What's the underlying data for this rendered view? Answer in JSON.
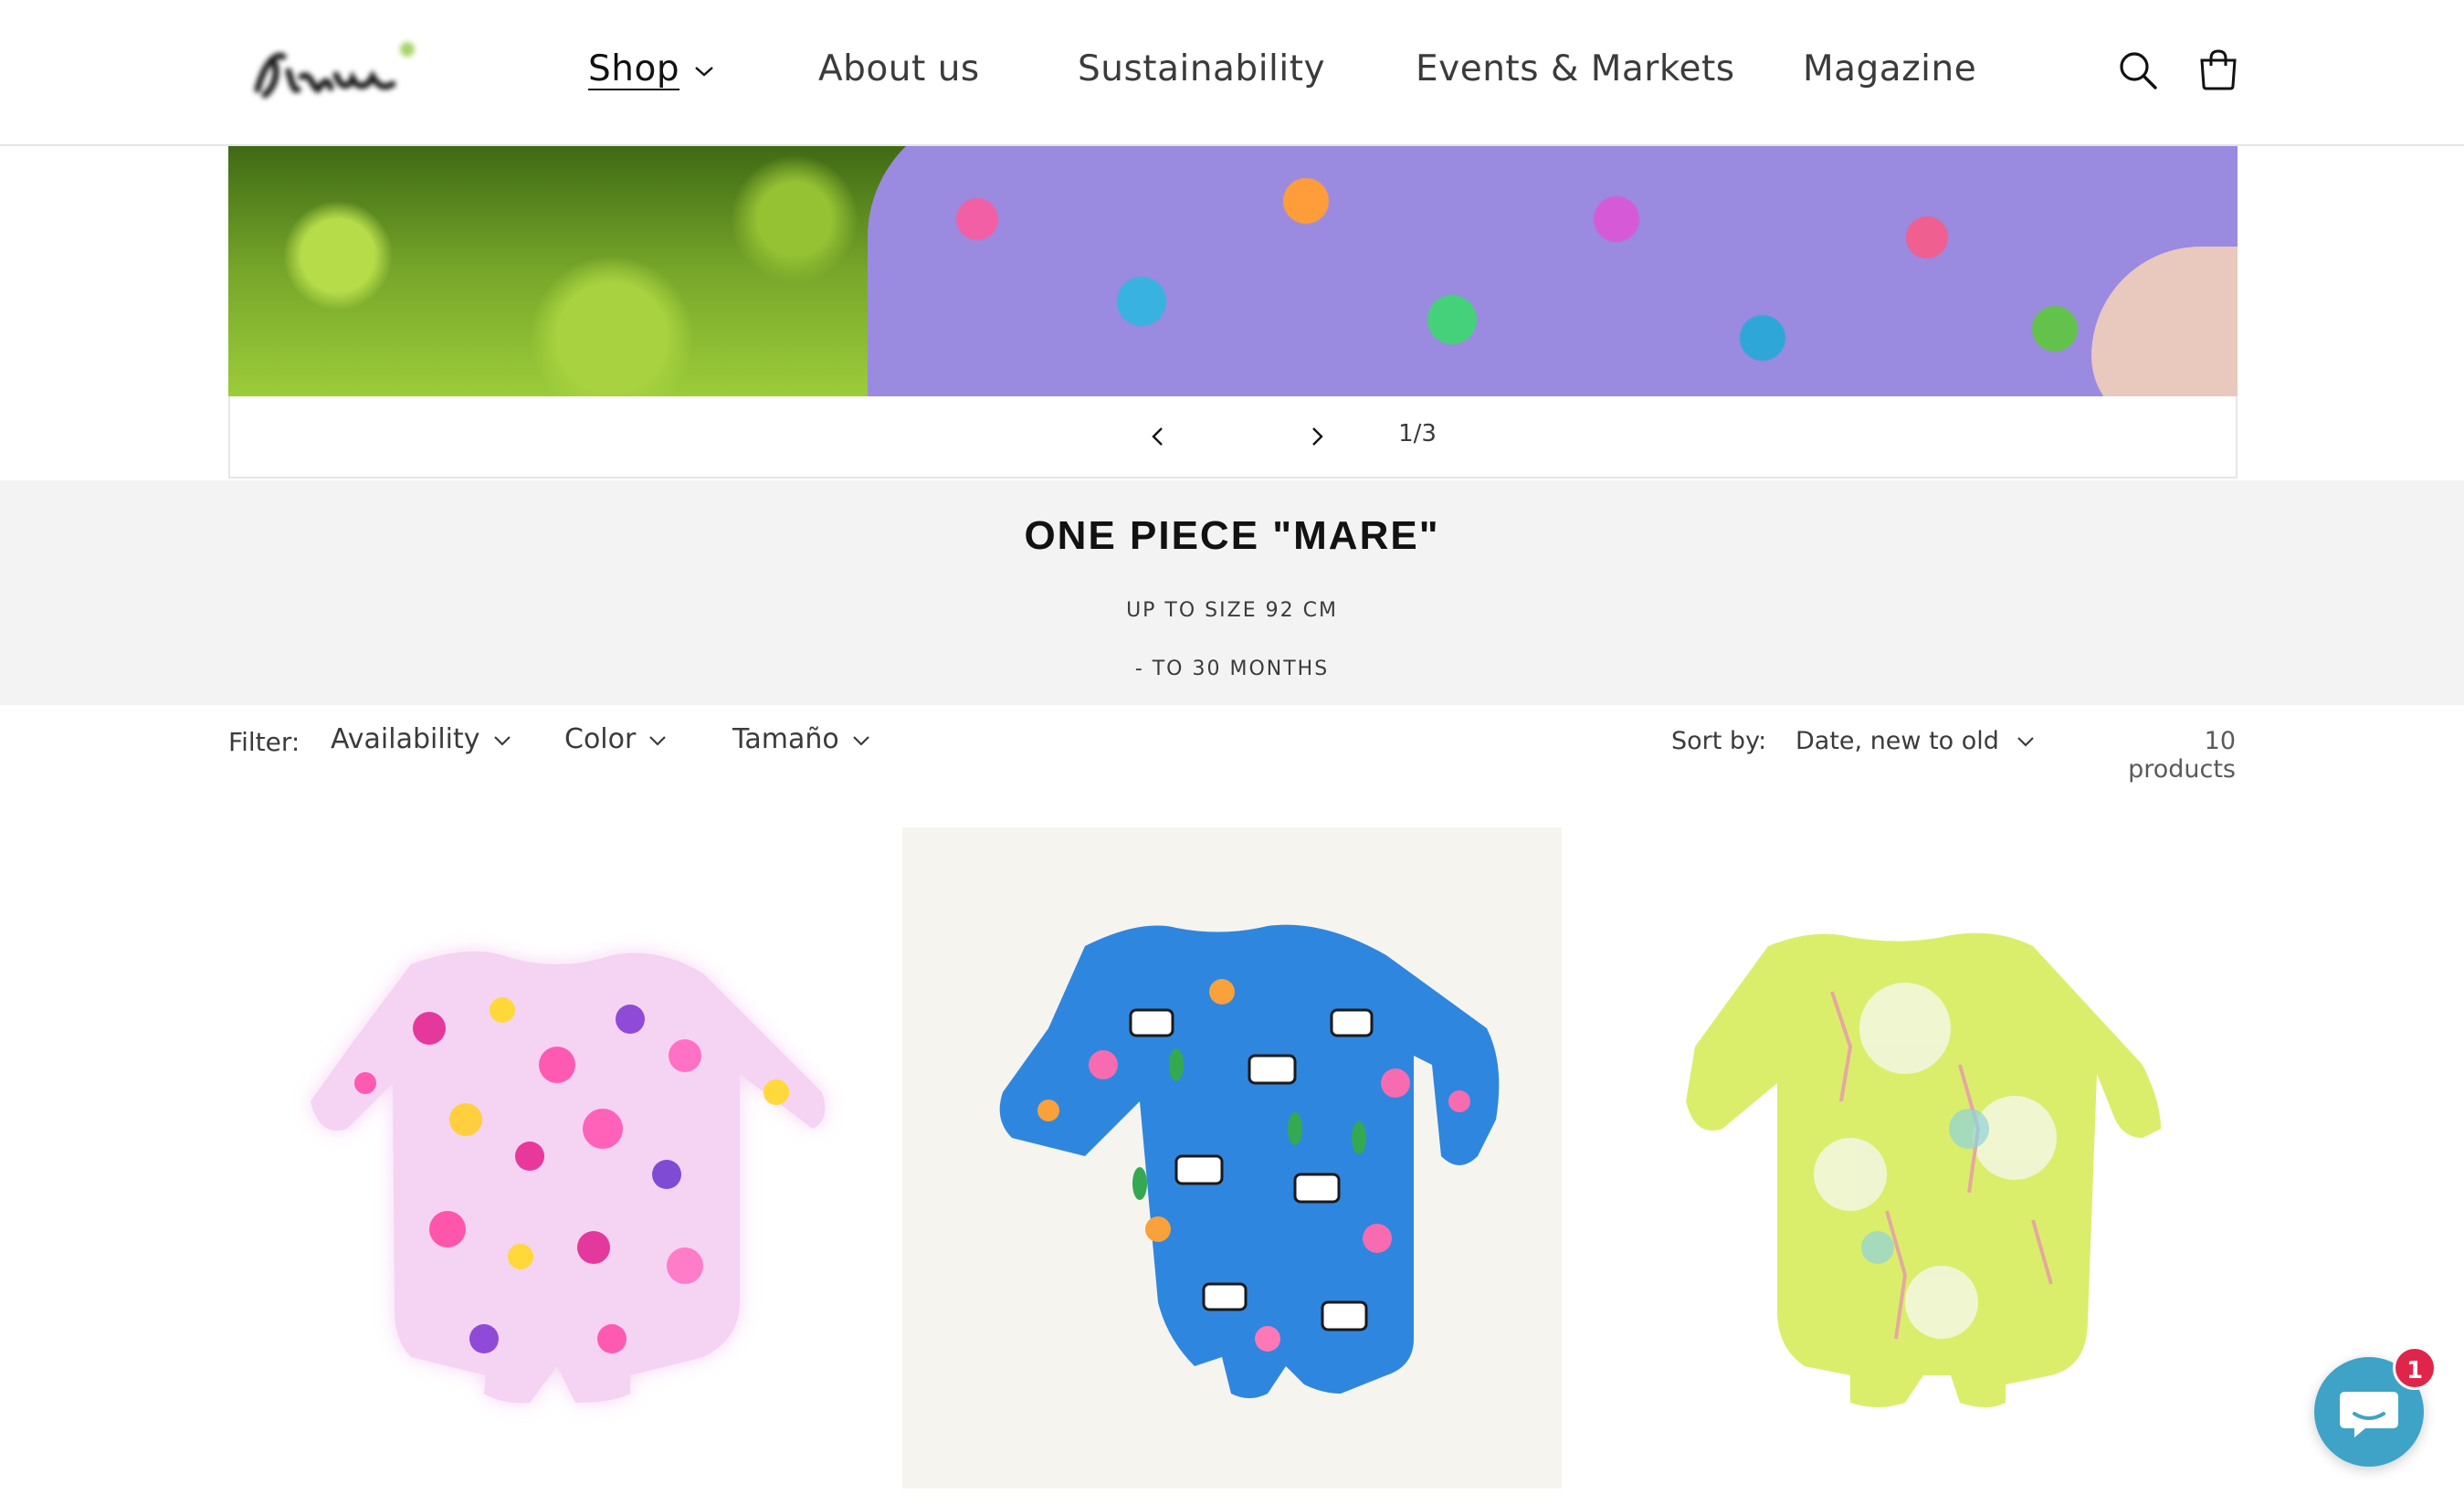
{
  "header": {
    "logo_text": "Ximbo",
    "nav": [
      {
        "label": "Shop",
        "has_dropdown": true,
        "active": true
      },
      {
        "label": "About us"
      },
      {
        "label": "Sustainability"
      },
      {
        "label": "Events & Markets"
      },
      {
        "label": "Magazine"
      }
    ],
    "icons": [
      "search-icon",
      "cart-icon"
    ]
  },
  "slideshow": {
    "counter": "1/3"
  },
  "collection": {
    "title": "ONE PIECE \"MARE\"",
    "line1": "UP TO SIZE 92 CM",
    "line2": "- TO 30 MONTHS"
  },
  "filters": {
    "label": "Filter:",
    "items": [
      "Availability",
      "Color",
      "Tamaño"
    ],
    "sort_label": "Sort by:",
    "sort_value": "Date, new to old",
    "product_count": "10 products"
  },
  "products": [
    {
      "name": "pink-floral-swimsuit",
      "color": "#f1c6ea"
    },
    {
      "name": "blue-zebra-swimsuit",
      "color": "#2f86de"
    },
    {
      "name": "lime-giraffe-swimsuit",
      "color": "#d9ec6a"
    }
  ],
  "chat": {
    "badge_count": "1",
    "accent": "#3fa3c8"
  },
  "colors": {
    "banner_bg": "#f3f3f3",
    "text": "#121212",
    "muted_text": "#3b3b3b",
    "badge": "#e0254b"
  }
}
